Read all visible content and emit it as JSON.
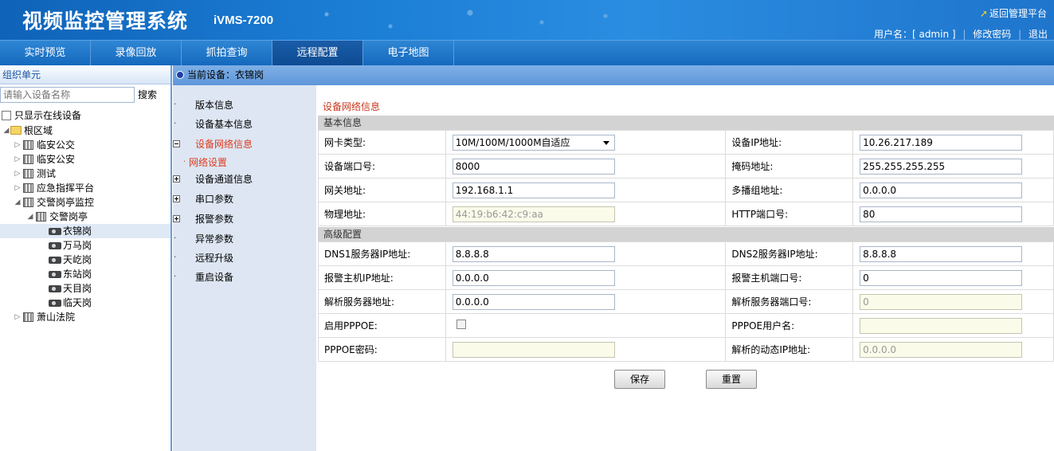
{
  "header": {
    "title": "视频监控管理系统",
    "model": "iVMS-7200",
    "return_link": "返回管理平台",
    "user_label": "用户名：[ admin ]",
    "change_password": "修改密码",
    "logout": "退出"
  },
  "nav": {
    "tabs": [
      "实时预览",
      "录像回放",
      "抓拍查询",
      "远程配置",
      "电子地图"
    ],
    "active": "远程配置"
  },
  "left": {
    "org_title": "组织单元",
    "search_placeholder": "请输入设备名称",
    "search_button": "搜索",
    "online_only": "只显示在线设备",
    "tree": [
      {
        "label": "根区域",
        "icon": "folder-icon",
        "level": 0
      },
      {
        "label": "临安公交",
        "icon": "building-icon",
        "level": 1
      },
      {
        "label": "临安公安",
        "icon": "building-icon",
        "level": 1
      },
      {
        "label": "测试",
        "icon": "building-icon",
        "level": 1
      },
      {
        "label": "应急指挥平台",
        "icon": "building-icon",
        "level": 1
      },
      {
        "label": "交警岗亭监控",
        "icon": "building-icon",
        "level": 1
      },
      {
        "label": "交警岗亭",
        "icon": "building-icon",
        "level": 2
      },
      {
        "label": "衣锦岗",
        "icon": "camera-icon",
        "level": 3,
        "selected": true
      },
      {
        "label": "万马岗",
        "icon": "camera-icon",
        "level": 3
      },
      {
        "label": "天屹岗",
        "icon": "camera-icon",
        "level": 3
      },
      {
        "label": "东站岗",
        "icon": "camera-icon",
        "level": 3
      },
      {
        "label": "天目岗",
        "icon": "camera-icon",
        "level": 3
      },
      {
        "label": "临天岗",
        "icon": "camera-icon",
        "level": 3
      },
      {
        "label": "萧山法院",
        "icon": "building-icon",
        "level": 1
      }
    ]
  },
  "current_device": "当前设备：衣锦岗",
  "menu": {
    "items": [
      "版本信息",
      "设备基本信息",
      "设备网络信息",
      "网络设置",
      "设备通道信息",
      "串口参数",
      "报警参数",
      "异常参数",
      "远程升级",
      "重启设备"
    ],
    "active": "设备网络信息",
    "active_sub": "网络设置"
  },
  "content": {
    "title": "设备网络信息",
    "basic_section": "基本信息",
    "advanced_section": "高级配置",
    "fields": {
      "nic_type_label": "网卡类型:",
      "nic_type_value": "10M/100M/1000M自适应",
      "ip_label": "设备IP地址:",
      "ip_value": "10.26.217.189",
      "port_label": "设备端口号:",
      "port_value": "8000",
      "mask_label": "掩码地址:",
      "mask_value": "255.255.255.255",
      "gateway_label": "网关地址:",
      "gateway_value": "192.168.1.1",
      "multicast_label": "多播组地址:",
      "multicast_value": "0.0.0.0",
      "mac_label": "物理地址:",
      "mac_value": "44:19:b6:42:c9:aa",
      "http_port_label": "HTTP端口号:",
      "http_port_value": "80",
      "dns1_label": "DNS1服务器IP地址:",
      "dns1_value": "8.8.8.8",
      "dns2_label": "DNS2服务器IP地址:",
      "dns2_value": "8.8.8.8",
      "alarm_host_ip_label": "报警主机IP地址:",
      "alarm_host_ip_value": "0.0.0.0",
      "alarm_host_port_label": "报警主机端口号:",
      "alarm_host_port_value": "0",
      "resolver_addr_label": "解析服务器地址:",
      "resolver_addr_value": "0.0.0.0",
      "resolver_port_label": "解析服务器端口号:",
      "resolver_port_value": "0",
      "pppoe_enable_label": "启用PPPOE:",
      "pppoe_user_label": "PPPOE用户名:",
      "pppoe_user_value": "",
      "pppoe_pwd_label": "PPPOE密码:",
      "pppoe_pwd_value": "",
      "dyn_ip_label": "解析的动态IP地址:",
      "dyn_ip_value": "0.0.0.0"
    },
    "save_button": "保存",
    "reset_button": "重置"
  }
}
